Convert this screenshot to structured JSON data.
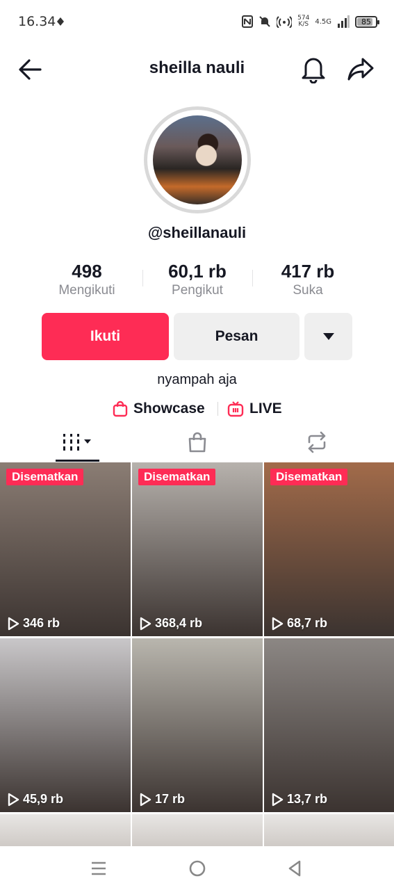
{
  "status_bar": {
    "time": "16.34",
    "net_speed_value": "574",
    "net_speed_unit": "K/S",
    "network": "4.5G",
    "battery": "85",
    "battery_level": 0.85
  },
  "header": {
    "title": "sheilla nauli",
    "icons": [
      "back-arrow-icon",
      "bell-icon",
      "share-icon"
    ]
  },
  "profile": {
    "handle": "@sheillanauli",
    "bio": "nyampah aja"
  },
  "stats": [
    {
      "value": "498",
      "label": "Mengikuti"
    },
    {
      "value": "60,1 rb",
      "label": "Pengikut"
    },
    {
      "value": "417 rb",
      "label": "Suka"
    }
  ],
  "actions": {
    "follow_label": "Ikuti",
    "message_label": "Pesan"
  },
  "links": {
    "showcase_label": "Showcase",
    "live_label": "LIVE"
  },
  "tabs": [
    "videos-grid-icon",
    "shop-bag-icon",
    "repost-icon"
  ],
  "videos": [
    {
      "pinned": "Disematkan",
      "views": "346 rb",
      "bg": "#8b7d74"
    },
    {
      "pinned": "Disematkan",
      "views": "368,4 rb",
      "bg": "#b7b2ad"
    },
    {
      "pinned": "Disematkan",
      "views": "68,7 rb",
      "bg": "#a26b4a"
    },
    {
      "pinned": "",
      "views": "45,9 rb",
      "bg": "#c9c7c9"
    },
    {
      "pinned": "",
      "views": "17 rb",
      "bg": "#b9b6ae"
    },
    {
      "pinned": "",
      "views": "13,7 rb",
      "bg": "#8c8784"
    }
  ],
  "colors": {
    "accent": "#fe2c55",
    "text": "#161823",
    "muted": "#8a8b91"
  }
}
